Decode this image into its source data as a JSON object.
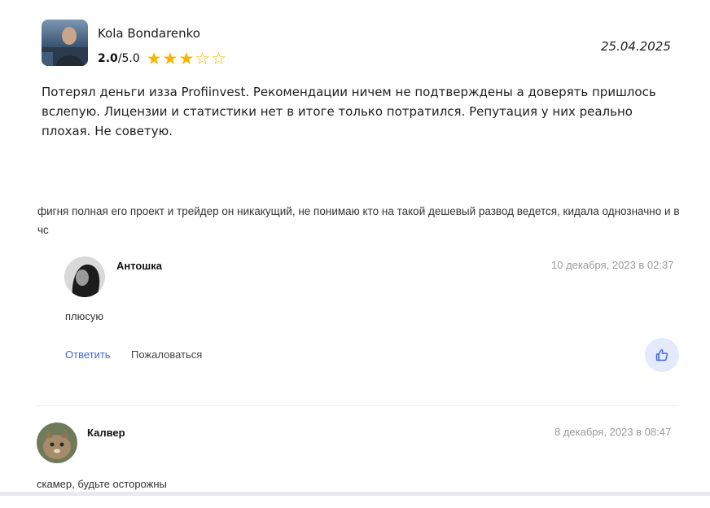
{
  "review": {
    "author": "Kola Bondarenko",
    "score": "2.0",
    "max": "/5.0",
    "rating_value": 2.5,
    "rating_max": 5,
    "date": "25.04.2025",
    "text": "Потерял деньги изза Profiinvest. Рекомендации ничем не подтверждены а доверять пришлось вслепую. Лицензии и статистики нет в итоге только потратился. Репутация у них реально плохая. Не советую.",
    "star_color": "#f7b500"
  },
  "main_comment": {
    "text": "фигня полная его проект и трейдер он никакущий, не понимаю кто на такой дешевый развод ведется, кидала однозначно и в чс"
  },
  "reply": {
    "name": "Антошка",
    "date": "10 декабря, 2023 в 02:37",
    "body": "плюсую",
    "answer_label": "Ответить",
    "report_label": "Пожаловаться",
    "like_icon": "thumbs-up-icon"
  },
  "comment2": {
    "name": "Калвер",
    "date": "8 декабря, 2023 в 08:47",
    "body": "скамер, будьте осторожны"
  },
  "colors": {
    "link": "#4267d3",
    "like_bg": "#e4e9fb",
    "muted": "#9a9a9a"
  }
}
